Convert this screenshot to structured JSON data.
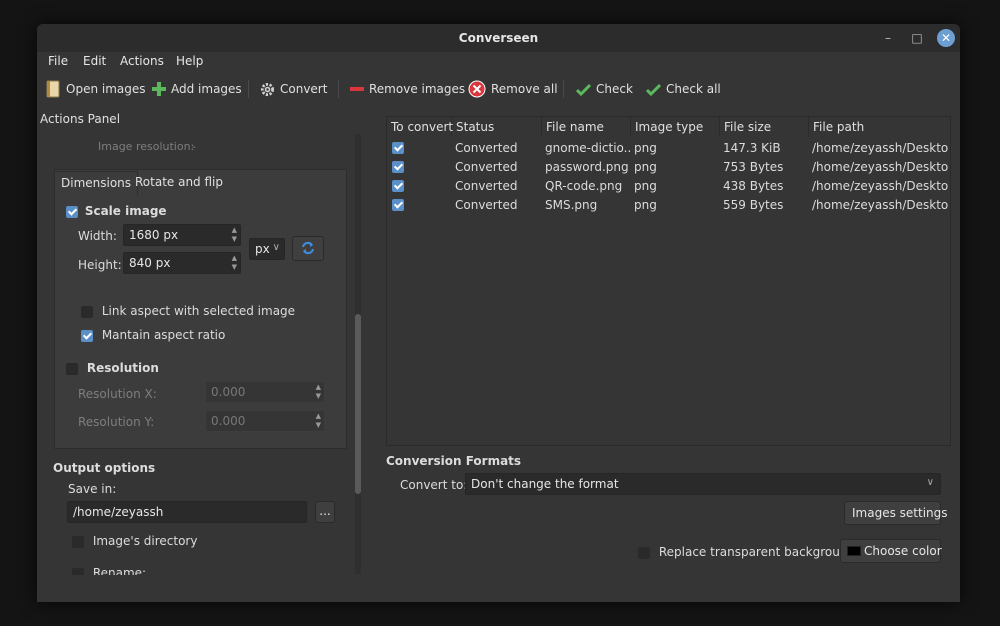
{
  "window": {
    "title": "Converseen"
  },
  "menu": [
    "File",
    "Edit",
    "Actions",
    "Help"
  ],
  "toolbar": {
    "open_images": "Open images",
    "add_images": "Add images",
    "convert": "Convert",
    "remove_images": "Remove images",
    "remove_all": "Remove all",
    "check": "Check",
    "check_all": "Check all"
  },
  "actions_panel": {
    "title": "Actions Panel",
    "image_resolution_label": "Image resolution:",
    "image_resolution_value": "-",
    "tabs": [
      "Dimensions",
      "Rotate and flip"
    ],
    "scale_image": {
      "label": "Scale image",
      "checked": true
    },
    "width_label": "Width:",
    "width_value": "1680 px",
    "height_label": "Height:",
    "height_value": "840 px",
    "unit": "px",
    "link_aspect": {
      "label": "Link aspect with selected image",
      "checked": false
    },
    "maintain_aspect": {
      "label": "Mantain aspect ratio",
      "checked": true
    },
    "resolution": {
      "label": "Resolution",
      "checked": false
    },
    "resolution_x_label": "Resolution X:",
    "resolution_x_value": "0.000",
    "resolution_y_label": "Resolution Y:",
    "resolution_y_value": "0.000",
    "output_options_title": "Output options",
    "save_in_label": "Save in:",
    "save_in_value": "/home/zeyassh",
    "browse_button": "...",
    "images_directory": {
      "label": "Image's directory",
      "checked": false
    },
    "rename": {
      "label": "Rename:",
      "checked": false
    }
  },
  "table": {
    "columns": [
      "To convert",
      "Status",
      "File name",
      "Image type",
      "File size",
      "File path"
    ],
    "rows": [
      {
        "checked": true,
        "status": "Converted",
        "file_name": "gnome-dictio...",
        "type": "png",
        "size": "147.3 KiB",
        "path": "/home/zeyassh/Desktop"
      },
      {
        "checked": true,
        "status": "Converted",
        "file_name": "password.png",
        "type": "png",
        "size": "753 Bytes",
        "path": "/home/zeyassh/Desktop"
      },
      {
        "checked": true,
        "status": "Converted",
        "file_name": "QR-code.png",
        "type": "png",
        "size": "438 Bytes",
        "path": "/home/zeyassh/Desktop"
      },
      {
        "checked": true,
        "status": "Converted",
        "file_name": "SMS.png",
        "type": "png",
        "size": "559 Bytes",
        "path": "/home/zeyassh/Desktop"
      }
    ]
  },
  "conversion": {
    "title": "Conversion Formats",
    "convert_to_label": "Convert to:",
    "convert_to_value": "Don't change the format",
    "images_settings": "Images settings",
    "replace_bg": {
      "label": "Replace transparent background",
      "checked": false
    },
    "choose_color": "Choose color",
    "color_swatch": "#000000"
  },
  "colors": {
    "accent": "#5a8fc7",
    "close_button": "#6e9fd3"
  }
}
